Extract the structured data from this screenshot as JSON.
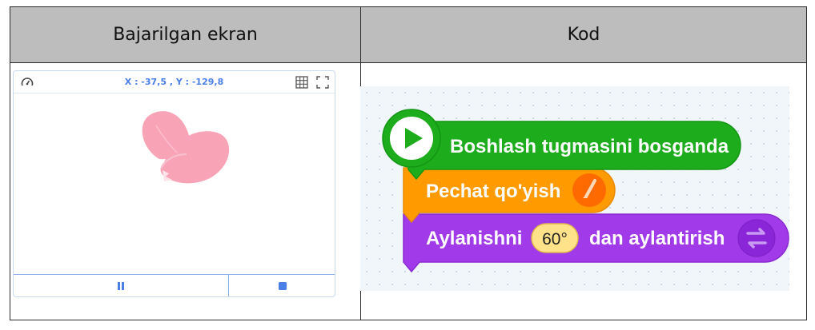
{
  "table": {
    "col_left": "Bajarilgan ekran",
    "col_right": "Kod"
  },
  "stage": {
    "coords": "X : -37,5 , Y : -129,8",
    "icons": [
      "speed-icon",
      "grid-icon",
      "fullscreen-icon",
      "pause-icon",
      "stop-icon"
    ],
    "sprite": "heart-petal"
  },
  "code": {
    "block1": "Boshlash tugmasini bosganda",
    "block2": "Pechat qo'yish",
    "block3_pre": "Aylanishni",
    "block3_value": "60°",
    "block3_post": "dan aylantirish"
  },
  "colors": {
    "header_bg": "#bdbdbd",
    "event_green": "#1cac1c",
    "pen_orange": "#ff9a00",
    "motion_purple": "#a13ae9",
    "stage_accent": "#4a7fe8",
    "sprite_pink": "#f9a3b6"
  }
}
